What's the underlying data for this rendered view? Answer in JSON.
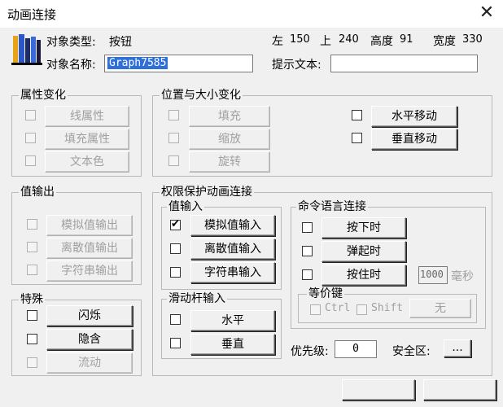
{
  "window": {
    "title": "动画连接",
    "close_glyph": "✕"
  },
  "object": {
    "type_label": "对象类型:",
    "type_value": "按钮",
    "name_label": "对象名称:",
    "name_value": "Graph7585",
    "left_label": "左",
    "left_value": "150",
    "top_label": "上",
    "top_value": "240",
    "height_label": "高度",
    "height_value": "91",
    "width_label": "宽度",
    "width_value": "330",
    "tooltip_label": "提示文本:",
    "tooltip_value": ""
  },
  "attr_change": {
    "title": "属性变化",
    "items": [
      "线属性",
      "填充属性",
      "文本色"
    ]
  },
  "pos_size": {
    "title": "位置与大小变化",
    "left_items": [
      "填充",
      "缩放",
      "旋转"
    ],
    "right_items": [
      "水平移动",
      "垂直移动"
    ]
  },
  "value_output": {
    "title": "值输出",
    "items": [
      "模拟值输出",
      "离散值输出",
      "字符串输出"
    ]
  },
  "special": {
    "title": "特殊",
    "items": [
      "闪烁",
      "隐含",
      "流动"
    ]
  },
  "protect": {
    "title": "权限保护动画连接"
  },
  "value_input": {
    "title": "值输入",
    "items": [
      "模拟值输入",
      "离散值输入",
      "字符串输入"
    ]
  },
  "command": {
    "title": "命令语言连接",
    "items": [
      "按下时",
      "弹起时",
      "按住时"
    ],
    "hold_value": "1000",
    "hold_unit": "毫秒"
  },
  "hotkey": {
    "title": "等价键",
    "ctrl": "Ctrl",
    "shift": "Shift",
    "key_button": "无"
  },
  "slider": {
    "title": "滑动杆输入",
    "items": [
      "水平",
      "垂直"
    ]
  },
  "priority": {
    "label": "优先级:",
    "value": "0"
  },
  "security": {
    "label": "安全区:",
    "button": "..."
  },
  "icons": {
    "app": "books-icon",
    "check": "✔"
  },
  "colors": {
    "selection": "#2f6fd6",
    "dialog_bg": "#f0f0f0"
  }
}
